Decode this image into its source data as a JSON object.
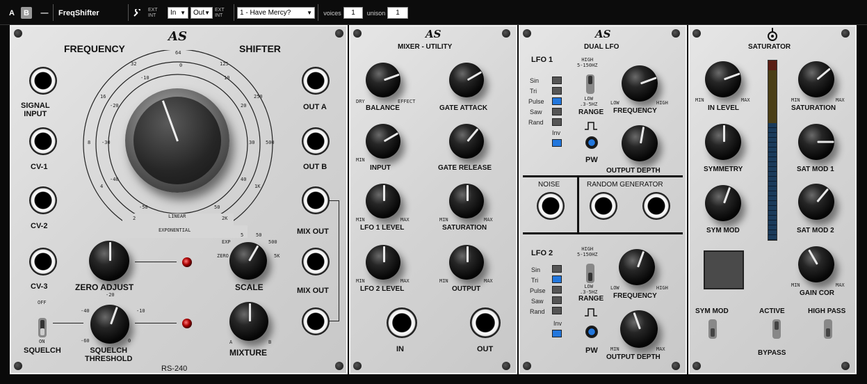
{
  "toolbar": {
    "a": "A",
    "b": "B",
    "dash": "—",
    "name": "FreqShifter",
    "wrench": "wrench-icon",
    "ext1": "EXT",
    "int1": "INT",
    "in": "In",
    "out": "Out",
    "ext2": "EXT",
    "int2": "INT",
    "preset": "1 - Have Mercy?",
    "voices_label": "voices",
    "voices": "1",
    "unison_label": "unison",
    "unison": "1"
  },
  "freq": {
    "logo": "AS",
    "title_left": "FREQUENCY",
    "title_right": "SHIFTER",
    "model": "RS-240",
    "jacks": [
      "SIGNAL\nINPUT",
      "CV-1",
      "CV-2",
      "CV-3"
    ],
    "outs": [
      "OUT A",
      "OUT B",
      "MIX OUT",
      "MIX OUT"
    ],
    "scale_top": [
      "64",
      "125",
      "250",
      "500",
      "1K",
      "2K"
    ],
    "scale_top_neg": [
      "32",
      "16",
      "8",
      "4",
      "2"
    ],
    "inner": [
      "-10",
      "0",
      "10",
      "20",
      "30",
      "40",
      "50",
      "-20",
      "-30",
      "-40",
      "-50"
    ],
    "linear": "LINEAR",
    "exponential": "EXPONENTIAL",
    "zero_adjust": "ZERO ADJUST",
    "squelch": "SQUELCH",
    "squelch_off": "OFF",
    "squelch_on": "ON",
    "thr_label": "SQUELCH\nTHRESHOLD",
    "thr_ticks": [
      "-40",
      "-20",
      "-10",
      "-60",
      "0"
    ],
    "scale_label": "SCALE",
    "scale_ticks": [
      "EXP",
      "5",
      "50",
      "500",
      "ZERO",
      "5K"
    ],
    "mixture": "MIXTURE",
    "mix_ticks": [
      "A",
      "B"
    ]
  },
  "mixer": {
    "logo": "AS",
    "title": "MIXER - UTILITY",
    "knobs": [
      "BALANCE",
      "INPUT",
      "LFO 1 LEVEL",
      "LFO 2 LEVEL",
      "GATE ATTACK",
      "GATE RELEASE",
      "SATURATION",
      "OUTPUT"
    ],
    "dry": "DRY",
    "effect": "EFFECT",
    "min": "MIN",
    "max": "MAX",
    "in": "IN",
    "out": "OUT"
  },
  "lfo": {
    "logo": "AS",
    "title": "DUAL LFO",
    "lfo1": "LFO 1",
    "lfo2": "LFO 2",
    "waves": [
      "Sin",
      "Tri",
      "Pulse",
      "Saw",
      "Rand"
    ],
    "inv": "Inv",
    "range": "RANGE",
    "high": "HIGH\n5-150HZ",
    "low": "LOW\n.3-5HZ",
    "frequency": "FREQUENCY",
    "low_t": "LOW",
    "high_t": "HIGH",
    "pw": "PW",
    "output_depth": "OUTPUT DEPTH",
    "noise": "NOISE",
    "random": "RANDOM GENERATOR",
    "min": "MIN",
    "max": "MAX",
    "lfo1_wave": "Pulse",
    "lfo2_wave": "Tri"
  },
  "sat": {
    "title": "SATURATOR",
    "knobs": [
      "IN LEVEL",
      "SYMMETRY",
      "SYM MOD",
      "SATURATION",
      "SAT MOD 1",
      "SAT MOD 2",
      "GAIN COR"
    ],
    "min": "MIN",
    "max": "MAX",
    "sym_mod": "SYM MOD",
    "active": "ACTIVE",
    "high_pass": "HIGH PASS",
    "bypass": "BYPASS"
  },
  "colors": {
    "led_blue": "#2277dd",
    "panel": "#d8d8d8"
  }
}
